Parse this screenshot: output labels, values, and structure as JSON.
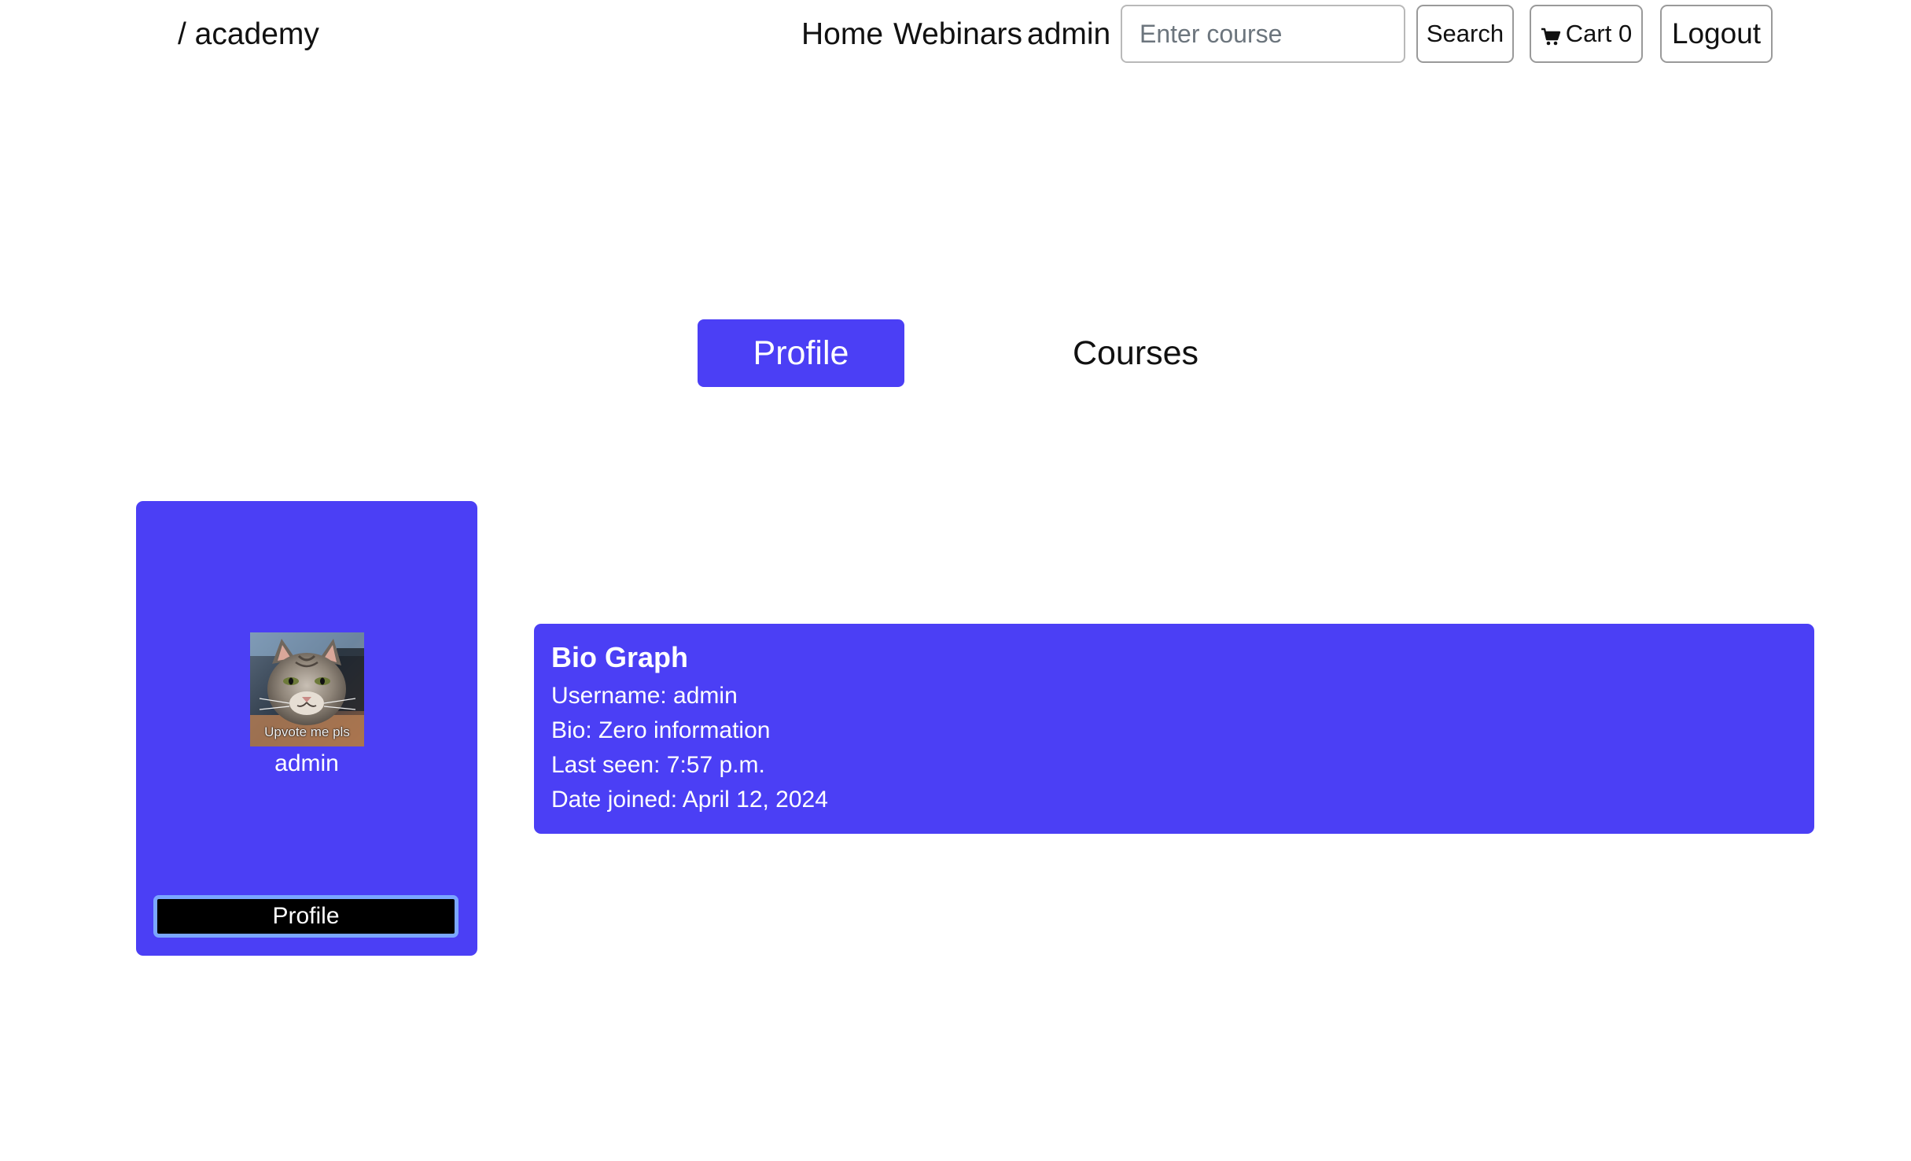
{
  "header": {
    "brand": "/ academy",
    "nav": {
      "home": "Home",
      "webinars": "Webinars",
      "admin": "admin"
    },
    "search": {
      "placeholder": "Enter course",
      "value": "",
      "button_label": "Search"
    },
    "cart": {
      "label": "Cart 0",
      "icon": "cart-icon"
    },
    "logout_label": "Logout"
  },
  "tabs": {
    "profile": "Profile",
    "courses": "Courses",
    "active": "profile"
  },
  "profile_card": {
    "avatar_caption": "Upvote me pls",
    "username": "admin",
    "button_label": "Profile"
  },
  "bio": {
    "title": "Bio Graph",
    "username": "Username: admin",
    "bio": "Bio: Zero information",
    "last_seen": "Last seen: 7:57 p.m.",
    "date_joined": "Date joined: April 12, 2024"
  },
  "colors": {
    "accent": "#4b3ff5",
    "button_dark": "#000000",
    "focus_ring": "#7aa6ff"
  }
}
